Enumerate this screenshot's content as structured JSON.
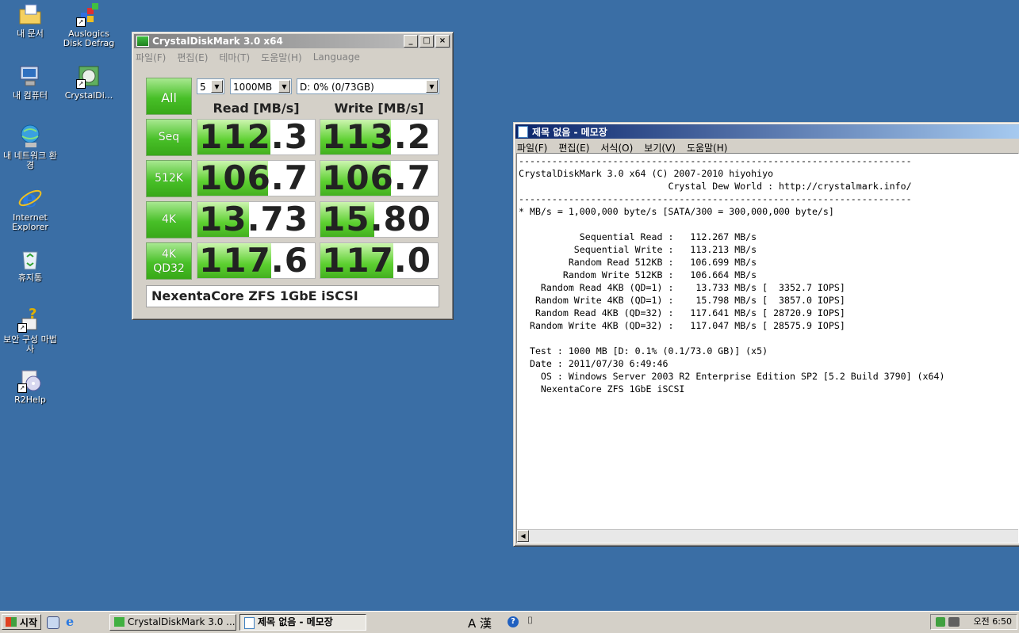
{
  "desktop": {
    "icons": [
      {
        "label": "내 문서"
      },
      {
        "label": "Auslogics Disk Defrag"
      },
      {
        "label": "내 컴퓨터"
      },
      {
        "label": "CrystalDi..."
      },
      {
        "label": "내 네트워크 환경"
      },
      {
        "label": "Internet Explorer"
      },
      {
        "label": "휴지통"
      },
      {
        "label": "보안 구성 마법사"
      },
      {
        "label": "R2Help"
      }
    ]
  },
  "cdm": {
    "title": "CrystalDiskMark 3.0 x64",
    "menu": [
      "파일(F)",
      "편집(E)",
      "테마(T)",
      "도움말(H)",
      "Language"
    ],
    "all_label": "All",
    "count": "5",
    "size": "1000MB",
    "drive": "D: 0% (0/73GB)",
    "read_header": "Read [MB/s]",
    "write_header": "Write [MB/s]",
    "rows": [
      {
        "label": "Seq",
        "read": "112.3",
        "write": "113.2",
        "read_fill": 0.62,
        "write_fill": 0.6
      },
      {
        "label": "512K",
        "read": "106.7",
        "write": "106.7",
        "read_fill": 0.6,
        "write_fill": 0.6
      },
      {
        "label": "4K",
        "read": "13.73",
        "write": "15.80",
        "read_fill": 0.44,
        "write_fill": 0.46
      },
      {
        "label": "4K",
        "label2": "QD32",
        "read": "117.6",
        "write": "117.0",
        "read_fill": 0.63,
        "write_fill": 0.62
      }
    ],
    "comment": "NexentaCore ZFS 1GbE iSCSI"
  },
  "notepad": {
    "title": "제목 없음 - 메모장",
    "menu": [
      "파일(F)",
      "편집(E)",
      "서식(O)",
      "보기(V)",
      "도움말(H)"
    ],
    "lines": [
      "-----------------------------------------------------------------------",
      "CrystalDiskMark 3.0 x64 (C) 2007-2010 hiyohiyo",
      "                           Crystal Dew World : http://crystalmark.info/",
      "-----------------------------------------------------------------------",
      "* MB/s = 1,000,000 byte/s [SATA/300 = 300,000,000 byte/s]",
      "",
      "           Sequential Read :   112.267 MB/s",
      "          Sequential Write :   113.213 MB/s",
      "         Random Read 512KB :   106.699 MB/s",
      "        Random Write 512KB :   106.664 MB/s",
      "    Random Read 4KB (QD=1) :    13.733 MB/s [  3352.7 IOPS]",
      "   Random Write 4KB (QD=1) :    15.798 MB/s [  3857.0 IOPS]",
      "   Random Read 4KB (QD=32) :   117.641 MB/s [ 28720.9 IOPS]",
      "  Random Write 4KB (QD=32) :   117.047 MB/s [ 28575.9 IOPS]",
      "",
      "  Test : 1000 MB [D: 0.1% (0.1/73.0 GB)] (x5)",
      "  Date : 2011/07/30 6:49:46",
      "    OS : Windows Server 2003 R2 Enterprise Edition SP2 [5.2 Build 3790] (x64)",
      "    NexentaCore ZFS 1GbE iSCSI"
    ]
  },
  "taskbar": {
    "start_label": "시작",
    "tasks": [
      {
        "label": "CrystalDiskMark 3.0 ..."
      },
      {
        "label": "제목 없음 - 메모장"
      }
    ],
    "ime": "A 漢",
    "clock": "오전 6:50"
  }
}
